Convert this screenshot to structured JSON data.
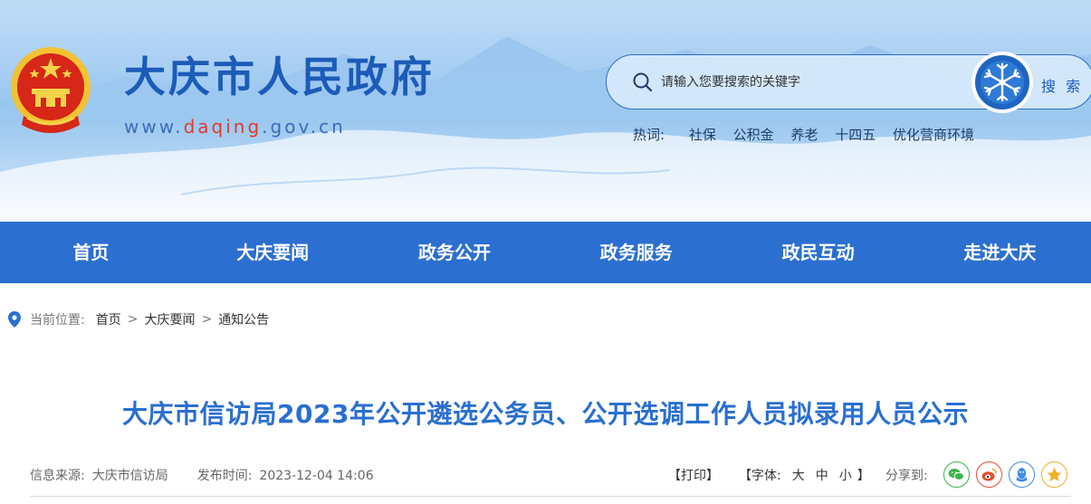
{
  "header": {
    "site_title": "大庆市人民政府",
    "url_prefix": "www.",
    "url_highlight": "daqing",
    "url_suffix": ".gov.cn"
  },
  "search": {
    "placeholder": "请输入您要搜索的关键字",
    "button_label": "搜 索",
    "hot_label": "热词:",
    "hot_words": [
      "社保",
      "公积金",
      "养老",
      "十四五",
      "优化营商环境"
    ]
  },
  "nav": {
    "items": [
      "首页",
      "大庆要闻",
      "政务公开",
      "政务服务",
      "政民互动",
      "走进大庆"
    ]
  },
  "breadcrumb": {
    "label": "当前位置:",
    "items": [
      "首页",
      "大庆要闻",
      "通知公告"
    ],
    "separator": ">"
  },
  "article": {
    "title": "大庆市信访局2023年公开遴选公务员、公开选调工作人员拟录用人员公示",
    "source_label": "信息来源:",
    "source": "大庆市信访局",
    "date_label": "发布时间:",
    "date": "2023-12-04 14:06",
    "print_label": "【打印】",
    "font_label": "【字体:",
    "font_sizes": [
      "大",
      "中",
      "小"
    ],
    "font_close": "】",
    "share_label": "分享到:"
  },
  "colors": {
    "brand_blue": "#2b6fd0",
    "title_blue": "#1c5bb8",
    "url_red": "#e03a2b",
    "wechat": "#3bb54a",
    "weibo": "#e6502f",
    "qq": "#3d8ee6",
    "qzone": "#f0b028"
  },
  "icons": [
    "national-emblem-icon",
    "search-icon",
    "snowflake-badge-icon",
    "location-pin-icon",
    "wechat-icon",
    "weibo-icon",
    "qq-icon",
    "qzone-icon"
  ]
}
